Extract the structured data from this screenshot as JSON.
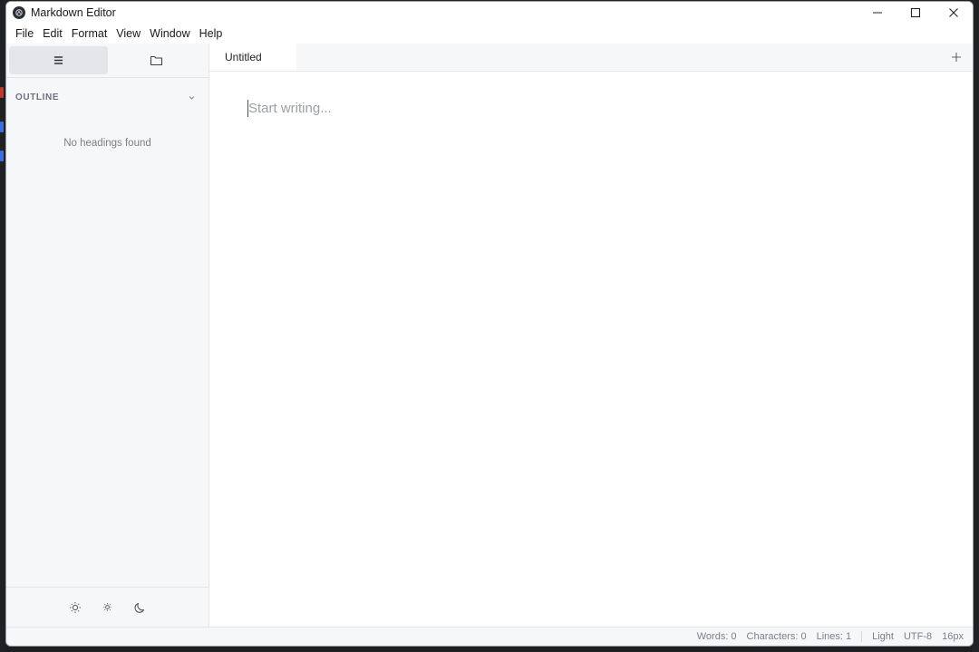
{
  "window": {
    "title": "Markdown Editor"
  },
  "menu": [
    "File",
    "Edit",
    "Format",
    "View",
    "Window",
    "Help"
  ],
  "sidebar": {
    "tabs": [
      {
        "icon": "list-icon",
        "active": true
      },
      {
        "icon": "folder-icon",
        "active": false
      }
    ],
    "outline_title": "OUTLINE",
    "empty_message": "No headings found",
    "theme_buttons": [
      "sun-icon",
      "sun-small-icon",
      "moon-icon"
    ]
  },
  "tabs": [
    {
      "label": "Untitled",
      "active": true
    }
  ],
  "editor": {
    "placeholder": "Start writing..."
  },
  "status": {
    "words": "Words: 0",
    "characters": "Characters: 0",
    "lines": "Lines: 1",
    "theme": "Light",
    "encoding": "UTF-8",
    "font_size": "16px"
  },
  "colors": {
    "sidebar_bg": "#f6f7f8",
    "active_tab_bg": "#e4e6ea",
    "placeholder": "#9aa0a6"
  }
}
